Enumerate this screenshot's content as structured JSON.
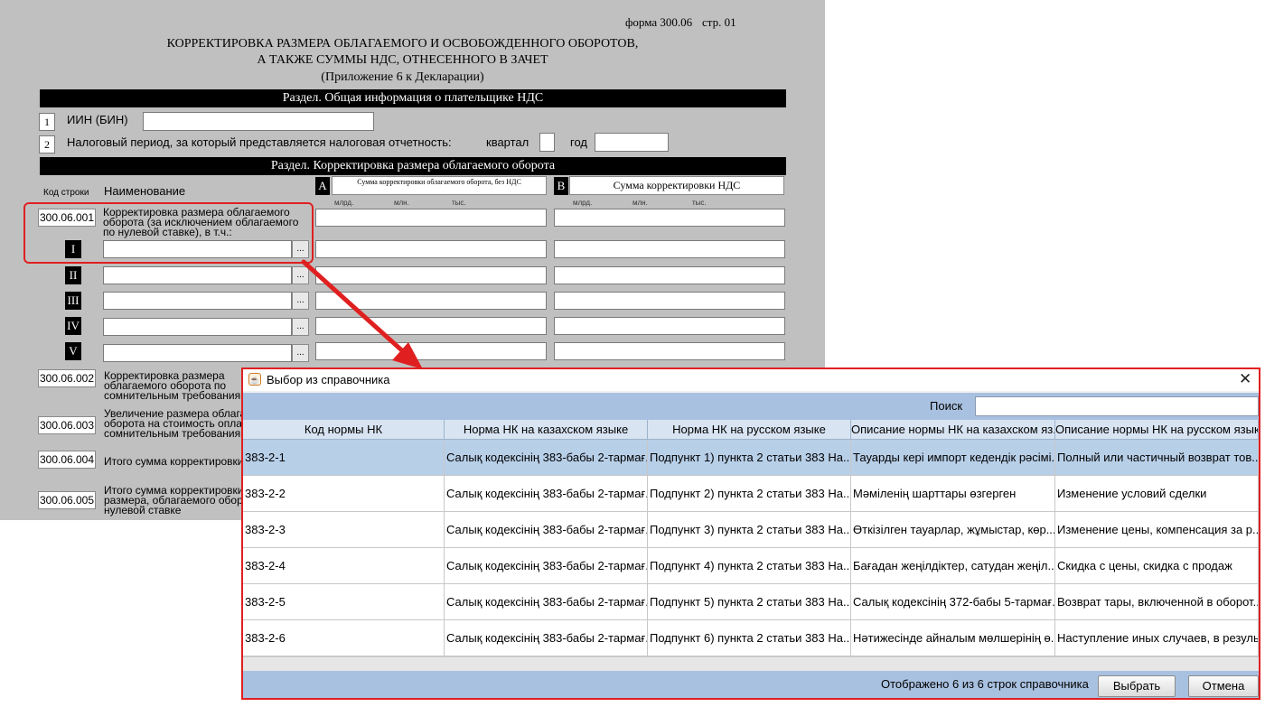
{
  "form": {
    "form_label": "форма 300.06",
    "page_label": "стр. 01",
    "title_line1": "КОРРЕКТИРОВКА РАЗМЕРА ОБЛАГАЕМОГО И ОСВОБОЖДЕННОГО ОБОРОТОВ,",
    "title_line2": "А ТАКЖЕ СУММЫ НДС, ОТНЕСЕННОГО В ЗАЧЕТ",
    "subtitle": "(Приложение 6 к Декларации)",
    "section1": "Раздел. Общая информация о плательщике НДС",
    "f1_num": "1",
    "f1_label": "ИИН (БИН)",
    "f2_num": "2",
    "f2_label": "Налоговый период, за который представляется налоговая отчетность:",
    "quarter_label": "квартал",
    "year_label": "год",
    "section2": "Раздел. Корректировка размера облагаемого оборота",
    "col_code": "Код строки",
    "col_name": "Наименование",
    "col_a_letter": "A",
    "col_a_title": "Сумма корректировки облагаемого оборота, без НДС",
    "col_b_letter": "B",
    "col_b_title": "Сумма корректировки НДС",
    "unit_mlrd": "млрд.",
    "unit_mln": "млн.",
    "unit_tys": "тыс.",
    "row001_code": "300.06.001",
    "row001_text": "Корректировка размера облагаемого оборота (за исключением облагаемого по нулевой ставке), в т.ч.:",
    "romans": [
      "I",
      "II",
      "III",
      "IV",
      "V"
    ],
    "dots": "...",
    "row002_code": "300.06.002",
    "row002_text": "Корректировка размера облагаемого оборота по сомнительным требованиям",
    "row003_code": "300.06.003",
    "row003_text": "Увеличение размера облагаемого оборота на стоимость оплаченных сомнительным требованиям",
    "row004_code": "300.06.004",
    "row004_text": "Итого сумма корректировки",
    "row005_code": "300.06.005",
    "row005_text": "Итого сумма корректировки размера, облагаемого оборота по нулевой ставке"
  },
  "dialog": {
    "title": "Выбор из справочника",
    "close_glyph": "✕",
    "search_label": "Поиск",
    "search_value": "",
    "columns": [
      "Код нормы НК",
      "Норма НК на казахском языке",
      "Норма НК на русском языке",
      "Описание нормы НК на казахском яз...",
      "Описание нормы НК на русском языке"
    ],
    "rows": [
      [
        "383-2-1",
        "Салық кодексінің 383-бабы 2-тармағ...",
        "Подпункт 1) пункта 2 статьи 383 На...",
        "Тауарды кері импорт кедендік рәсімі...",
        "Полный или частичный возврат тов..."
      ],
      [
        "383-2-2",
        "Салық кодексінің 383-бабы 2-тармағ...",
        "Подпункт 2) пункта 2 статьи 383 На...",
        "Мәміленің шарттары өзгерген",
        "Изменение условий сделки"
      ],
      [
        "383-2-3",
        "Салық кодексінің 383-бабы 2-тармағ...",
        "Подпункт 3) пункта 2 статьи 383 На...",
        "Өткізілген тауарлар, жұмыстар, көр...",
        "Изменение цены, компенсация за р..."
      ],
      [
        "383-2-4",
        "Салық кодексінің 383-бабы 2-тармағ...",
        "Подпункт 4) пункта 2 статьи 383 На...",
        "Бағадан жеңілдіктер, сатудан жеңіл...",
        "Скидка с цены, скидка с продаж"
      ],
      [
        "383-2-5",
        "Салық кодексінің 383-бабы 2-тармағ...",
        "Подпункт 5) пункта 2 статьи 383 На...",
        "Салық кодексінің 372-бабы 5-тармағ...",
        "Возврат тары, включенной в оборот..."
      ],
      [
        "383-2-6",
        "Салық кодексінің 383-бабы 2-тармағ...",
        "Подпункт 6) пункта 2 статьи 383 На...",
        "Нәтижесінде айналым мөлшерінің ө...",
        "Наступление иных случаев, в резуль..."
      ]
    ],
    "selected_row": 0,
    "status_text": "Отображено 6 из 6 строк справочника",
    "select_button": "Выбрать",
    "cancel_button": "Отмена"
  },
  "colors": {
    "highlight": "#e02020",
    "form_bg": "#c0c0c0",
    "header_blue": "#d8e4f2",
    "selected_row": "#b8cfe8"
  }
}
